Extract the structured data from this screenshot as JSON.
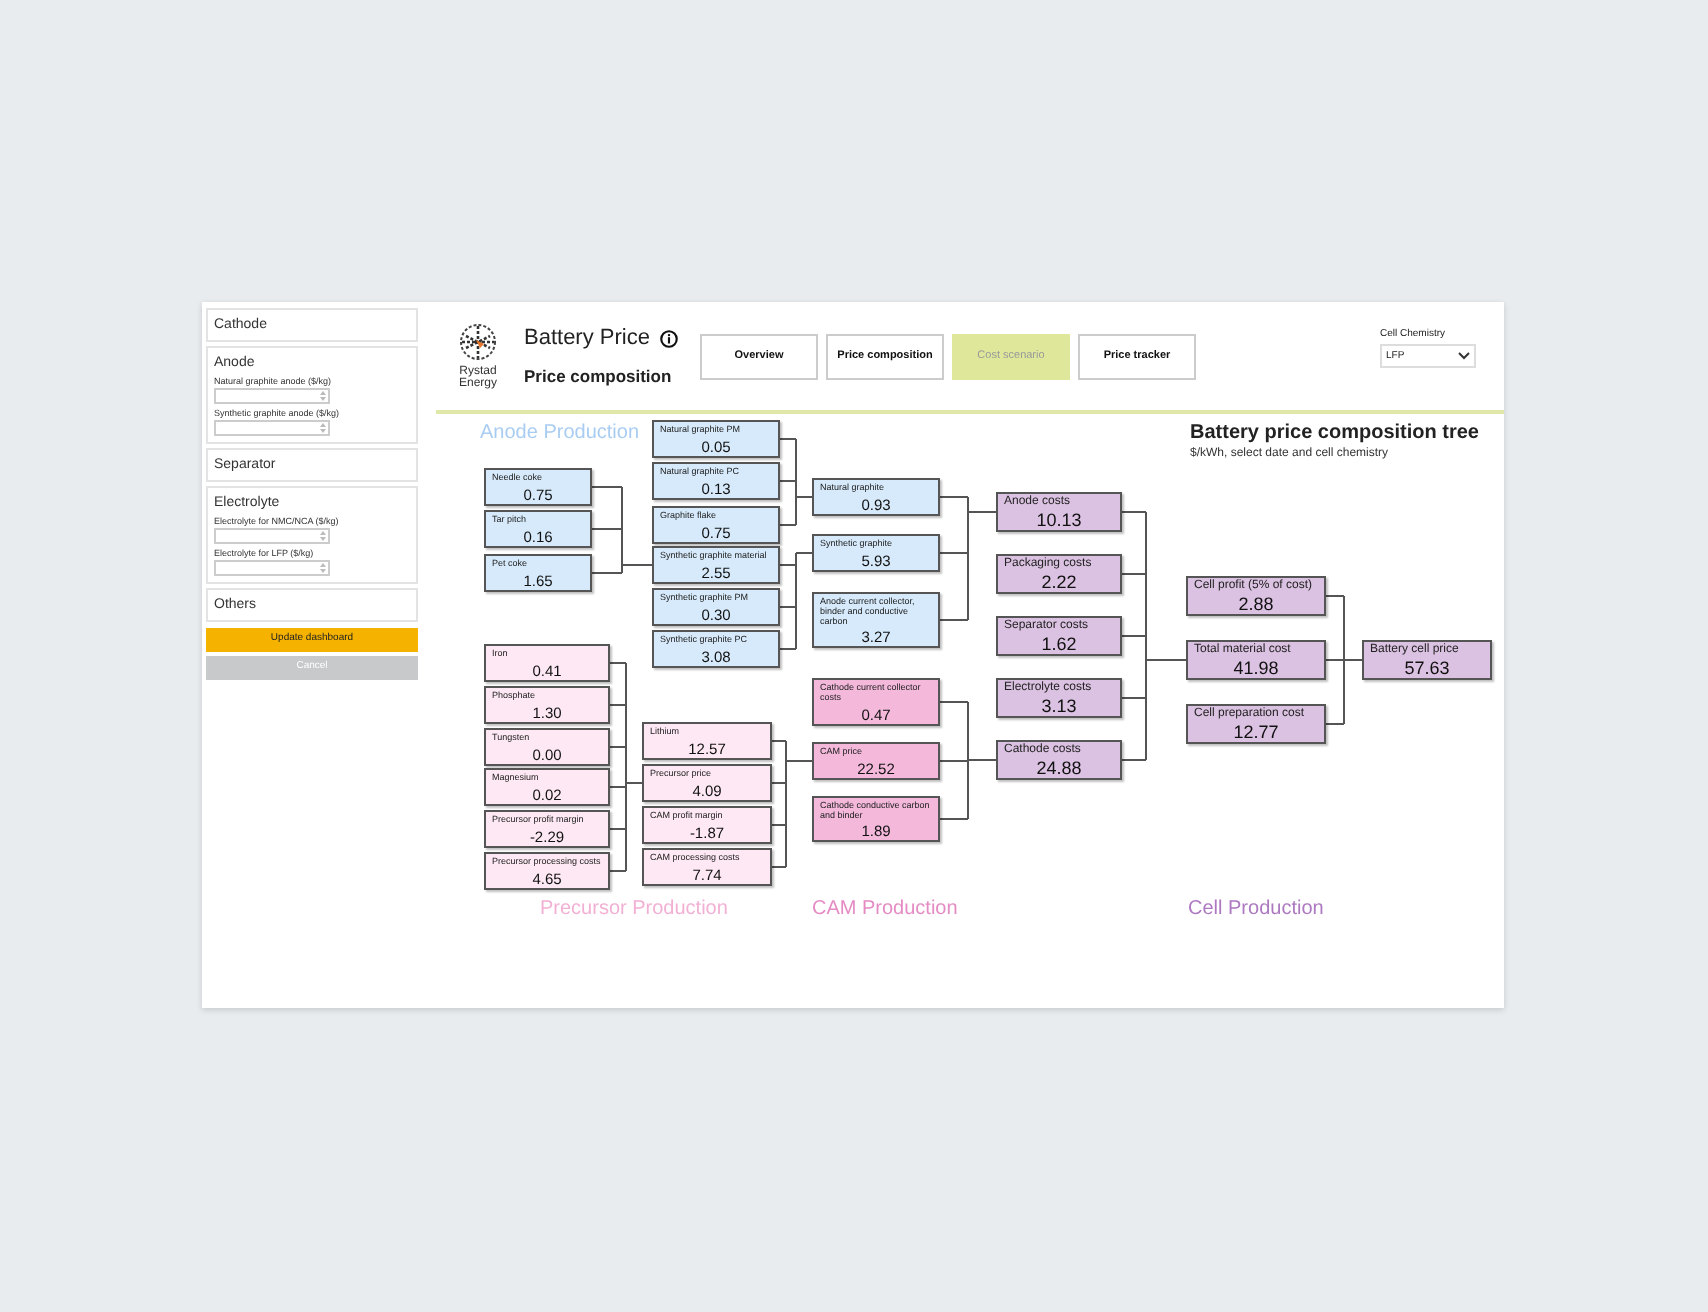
{
  "sidebar": {
    "sections": [
      {
        "title": "Cathode"
      },
      {
        "title": "Anode",
        "fields": [
          {
            "label": "Natural graphite anode ($/kg)"
          },
          {
            "label": "Synthetic graphite anode ($/kg)"
          }
        ]
      },
      {
        "title": "Separator"
      },
      {
        "title": "Electrolyte",
        "fields": [
          {
            "label": "Electrolyte for NMC/NCA ($/kg)"
          },
          {
            "label": "Electrolyte for LFP ($/kg)"
          }
        ]
      },
      {
        "title": "Others"
      }
    ],
    "buttons": [
      {
        "label": "Update dashboard",
        "kind": "primary"
      },
      {
        "label": "Cancel",
        "kind": "secondary"
      }
    ]
  },
  "header": {
    "logo_text": "Rystad Energy",
    "title": "Battery Price",
    "subtitle": "Price composition",
    "nav": [
      {
        "label": "Overview",
        "selected": false
      },
      {
        "label": "Price composition",
        "selected": false
      },
      {
        "label": "Cost scenario",
        "selected": true
      },
      {
        "label": "Price tracker",
        "selected": false
      }
    ],
    "filter": {
      "label": "Cell Chemistry",
      "value": "LFP"
    }
  },
  "tree": {
    "title": "Battery price composition tree",
    "subtitle": "$/kWh, select date and cell chemistry",
    "sections": [
      {
        "kind": "anode",
        "label": "Anode Production",
        "columns": [
          [
            {
              "name": "Needle coke",
              "value": "0.75"
            },
            {
              "name": "Tar pitch",
              "value": "0.16"
            },
            {
              "name": "Pet coke",
              "value": "1.65"
            }
          ],
          [
            {
              "name": "Natural graphite PM",
              "value": "0.05"
            },
            {
              "name": "Natural graphite PC",
              "value": "0.13"
            },
            {
              "name": "Graphite flake",
              "value": "0.75"
            },
            {
              "name": "Synthetic graphite material",
              "value": "2.55"
            },
            {
              "name": "Synthetic graphite PM",
              "value": "0.30"
            },
            {
              "name": "Synthetic graphite PC",
              "value": "3.08"
            }
          ],
          [
            {
              "name": "Natural graphite",
              "value": "0.93"
            },
            {
              "name": "Synthetic graphite",
              "value": "5.93"
            },
            {
              "name": "Anode current collector, binder and conductive carbon",
              "value": "3.27"
            }
          ]
        ]
      },
      {
        "kind": "precursor",
        "label": "Precursor Production",
        "columns": [
          [
            {
              "name": "Iron",
              "value": "0.41"
            },
            {
              "name": "Phosphate",
              "value": "1.30"
            },
            {
              "name": "Tungsten",
              "value": "0.00"
            },
            {
              "name": "Magnesium",
              "value": "0.02"
            },
            {
              "name": "Precursor profit margin",
              "value": "-2.29"
            },
            {
              "name": "Precursor processing costs",
              "value": "4.65"
            }
          ],
          [
            {
              "name": "Lithium",
              "value": "12.57"
            },
            {
              "name": "Precursor price",
              "value": "4.09"
            },
            {
              "name": "CAM profit margin",
              "value": "-1.87"
            },
            {
              "name": "CAM processing costs",
              "value": "7.74"
            }
          ]
        ]
      },
      {
        "kind": "cam",
        "label": "CAM Production",
        "columns": [
          [
            {
              "name": "Cathode current collector costs",
              "value": "0.47"
            },
            {
              "name": "CAM price",
              "value": "22.52"
            },
            {
              "name": "Cathode conductive carbon and binder",
              "value": "1.89"
            }
          ]
        ]
      },
      {
        "kind": "cell",
        "label": "Cell Production",
        "columns": [
          [
            {
              "name": "Anode costs",
              "value": "10.13"
            },
            {
              "name": "Packaging costs",
              "value": "2.22"
            },
            {
              "name": "Separator costs",
              "value": "1.62"
            },
            {
              "name": "Electrolyte costs",
              "value": "3.13"
            },
            {
              "name": "Cathode costs",
              "value": "24.88"
            }
          ],
          [
            {
              "name": "Cell profit (5% of cost)",
              "value": "2.88"
            },
            {
              "name": "Total material cost",
              "value": "41.98"
            },
            {
              "name": "Cell preparation cost",
              "value": "12.77"
            }
          ],
          [
            {
              "name": "Battery cell price",
              "value": "57.63"
            }
          ]
        ]
      }
    ]
  }
}
